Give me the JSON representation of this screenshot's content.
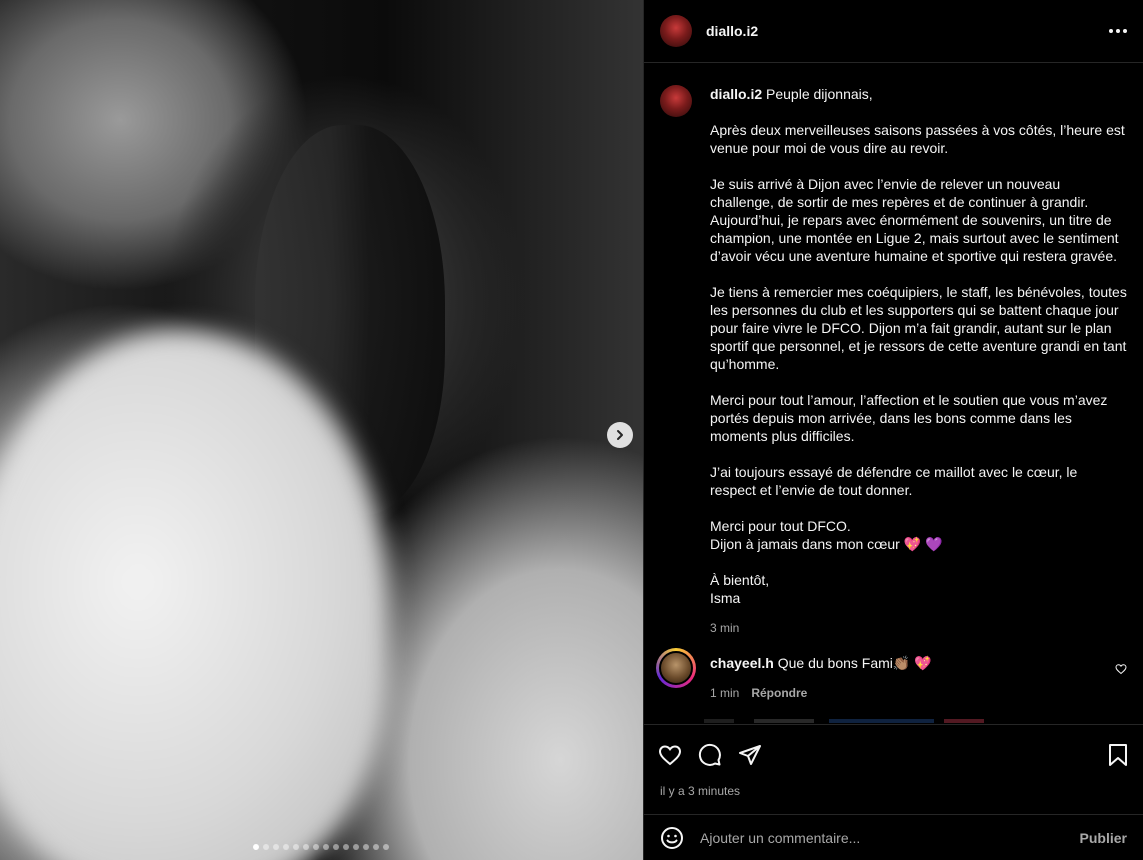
{
  "post": {
    "username": "diallo.i2",
    "caption_lines": [
      "Peuple dijonnais,",
      "",
      "Après deux merveilleuses saisons passées à vos côtés, l’heure est venue pour moi de vous dire au revoir.",
      "",
      "Je suis arrivé à Dijon avec l’envie de relever un nouveau challenge, de sortir de mes repères et de continuer à grandir. Aujourd’hui, je repars avec énormément de souvenirs, un titre de champion, une montée en Ligue 2, mais surtout avec le sentiment d’avoir vécu une aventure humaine et sportive qui restera gravée.",
      "",
      "Je tiens à remercier mes coéquipiers, le staff, les bénévoles, toutes les personnes du club et les supporters qui se battent chaque jour pour faire vivre le DFCO. Dijon m’a fait grandir, autant sur le plan sportif que personnel, et je ressors de cette aventure grandi en tant qu’homme.",
      "",
      "Merci pour tout l’amour, l’affection et le soutien que vous m’avez portés depuis mon arrivée, dans les bons comme dans les moments plus difficiles.",
      "",
      "J’ai toujours essayé de défendre ce maillot avec le cœur, le respect et l’envie de tout donner.",
      "",
      "Merci pour tout DFCO.",
      "Dijon à jamais dans mon cœur 💖 💜",
      "",
      "À bientôt,",
      "Isma"
    ],
    "caption_time": "3 min",
    "timestamp": "il y a 3 minutes",
    "carousel": {
      "count": 14,
      "active_index": 0
    }
  },
  "comment": {
    "username": "chayeel.h",
    "text": "Que du bons Fami👏🏽 💖",
    "time": "1 min",
    "reply_label": "Répondre"
  },
  "add_comment": {
    "placeholder": "Ajouter un commentaire...",
    "publish_label": "Publier"
  },
  "icons": {
    "more": "more-horizontal-icon",
    "next": "chevron-right-icon",
    "like": "heart-icon",
    "comment": "comment-bubble-icon",
    "share": "paper-plane-icon",
    "save": "bookmark-icon",
    "emoji": "smiley-icon"
  },
  "colors": {
    "background": "#000000",
    "muted": "#a8a8a8",
    "divider": "#262626"
  }
}
